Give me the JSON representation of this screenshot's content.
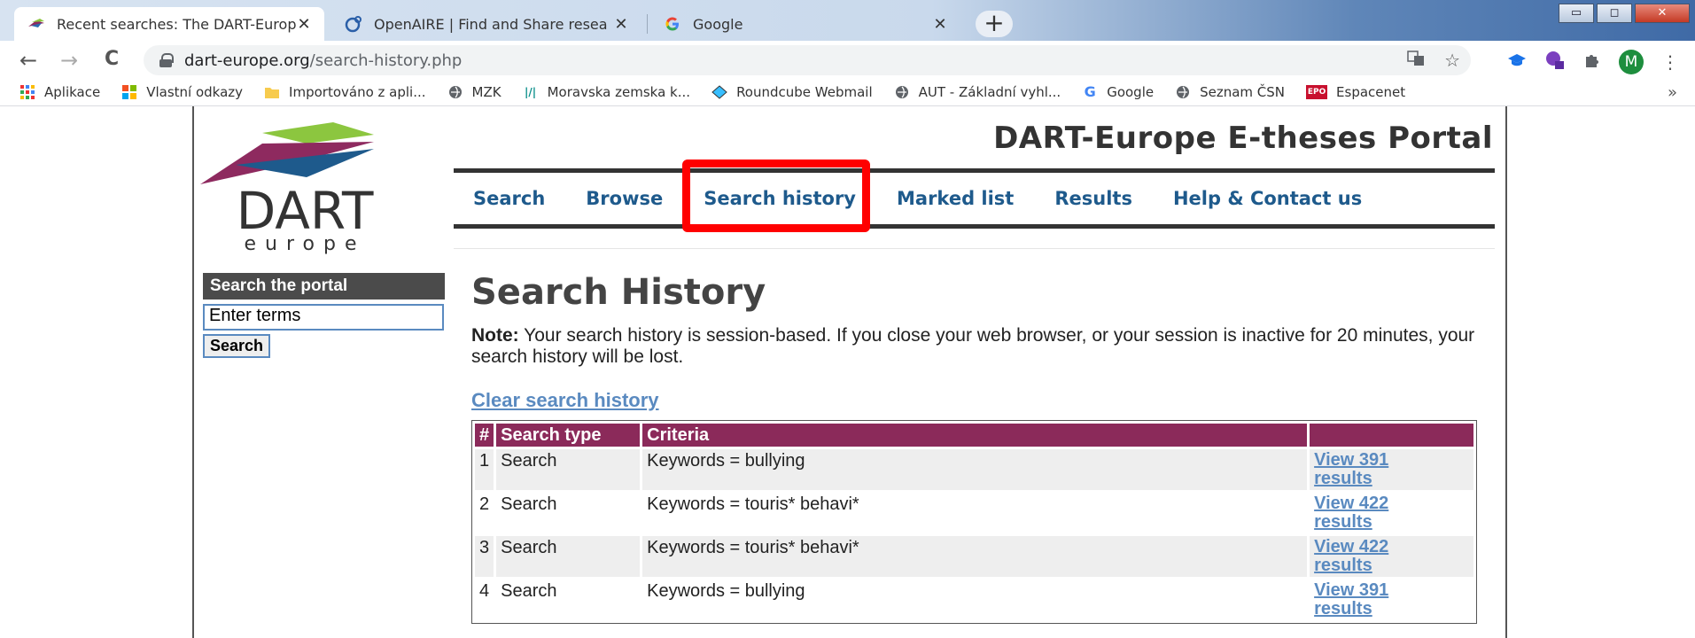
{
  "browser": {
    "tabs": [
      {
        "title": "Recent searches: The DART-Europ",
        "close": "✕"
      },
      {
        "title": "OpenAIRE | Find and Share resea",
        "close": "✕"
      },
      {
        "title": "Google",
        "close": "✕"
      }
    ],
    "new_tab": "+",
    "window_buttons": {
      "minimize": "▭",
      "maximize": "◻",
      "close": "✕"
    },
    "nav": {
      "back": "←",
      "forward": "→",
      "reload": "C"
    },
    "url_host": "dart-europe.org",
    "url_path": "/search-history.php",
    "profile_initial": "M",
    "bookmarks": [
      {
        "label": "Aplikace",
        "icon": "apps-grid-icon"
      },
      {
        "label": "Vlastní odkazy",
        "icon": "windows-icon"
      },
      {
        "label": "Importováno z apli...",
        "icon": "folder-icon"
      },
      {
        "label": "MZK",
        "icon": "globe-icon"
      },
      {
        "label": "Moravska zemska k...",
        "icon": "mzk-icon"
      },
      {
        "label": "Roundcube Webmail",
        "icon": "roundcube-icon"
      },
      {
        "label": "AUT - Základní vyhl...",
        "icon": "globe-icon"
      },
      {
        "label": "Google",
        "icon": "google-icon"
      },
      {
        "label": "Seznam ČSN",
        "icon": "globe-icon"
      },
      {
        "label": "Espacenet",
        "icon": "epo-icon"
      }
    ],
    "bookmarks_more": "»"
  },
  "site": {
    "title": "DART-Europe E-theses Portal",
    "logo_text": "DART",
    "logo_subtext": "europe",
    "nav": [
      "Search",
      "Browse",
      "Search history",
      "Marked list",
      "Results",
      "Help & Contact us"
    ]
  },
  "sidebar": {
    "heading": "Search the portal",
    "input_placeholder": "Enter terms",
    "button": "Search"
  },
  "main": {
    "title": "Search History",
    "note_label": "Note:",
    "note_text": " Your search history is session-based. If you close your web browser, or your session is inactive for 20 minutes, your search history will be lost.",
    "clear_link": "Clear search history",
    "table": {
      "headers": [
        "#",
        "Search type",
        "Criteria",
        ""
      ],
      "rows": [
        {
          "num": "1",
          "type": "Search",
          "criteria": "Keywords = bullying",
          "link_line1": "View 391",
          "link_line2": "results"
        },
        {
          "num": "2",
          "type": "Search",
          "criteria": "Keywords = touris* behavi*",
          "link_line1": "View 422",
          "link_line2": "results"
        },
        {
          "num": "3",
          "type": "Search",
          "criteria": "Keywords = touris* behavi*",
          "link_line1": "View 422",
          "link_line2": "results"
        },
        {
          "num": "4",
          "type": "Search",
          "criteria": "Keywords = bullying",
          "link_line1": "View 391",
          "link_line2": "results"
        }
      ]
    }
  },
  "colors": {
    "table_header": "#8b2a5a",
    "link": "#5a8ac0",
    "nav_link": "#1e5a8c",
    "highlight": "#ff0000"
  }
}
